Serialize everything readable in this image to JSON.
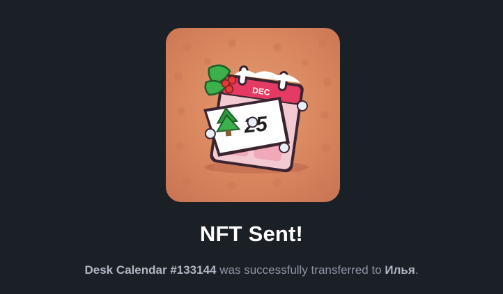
{
  "nft": {
    "icon": "desk-calendar-icon",
    "calendar_month": "DEC",
    "calendar_day": "25",
    "background_color": "#d9865f"
  },
  "dialog": {
    "title": "NFT Sent!",
    "item_name": "Desk Calendar #133144",
    "message_middle": " was successfully transferred to ",
    "recipient": "Илья",
    "message_end": "."
  },
  "colors": {
    "background": "#1b1f26",
    "title": "#ffffff",
    "subtitle": "#8c96a3"
  }
}
